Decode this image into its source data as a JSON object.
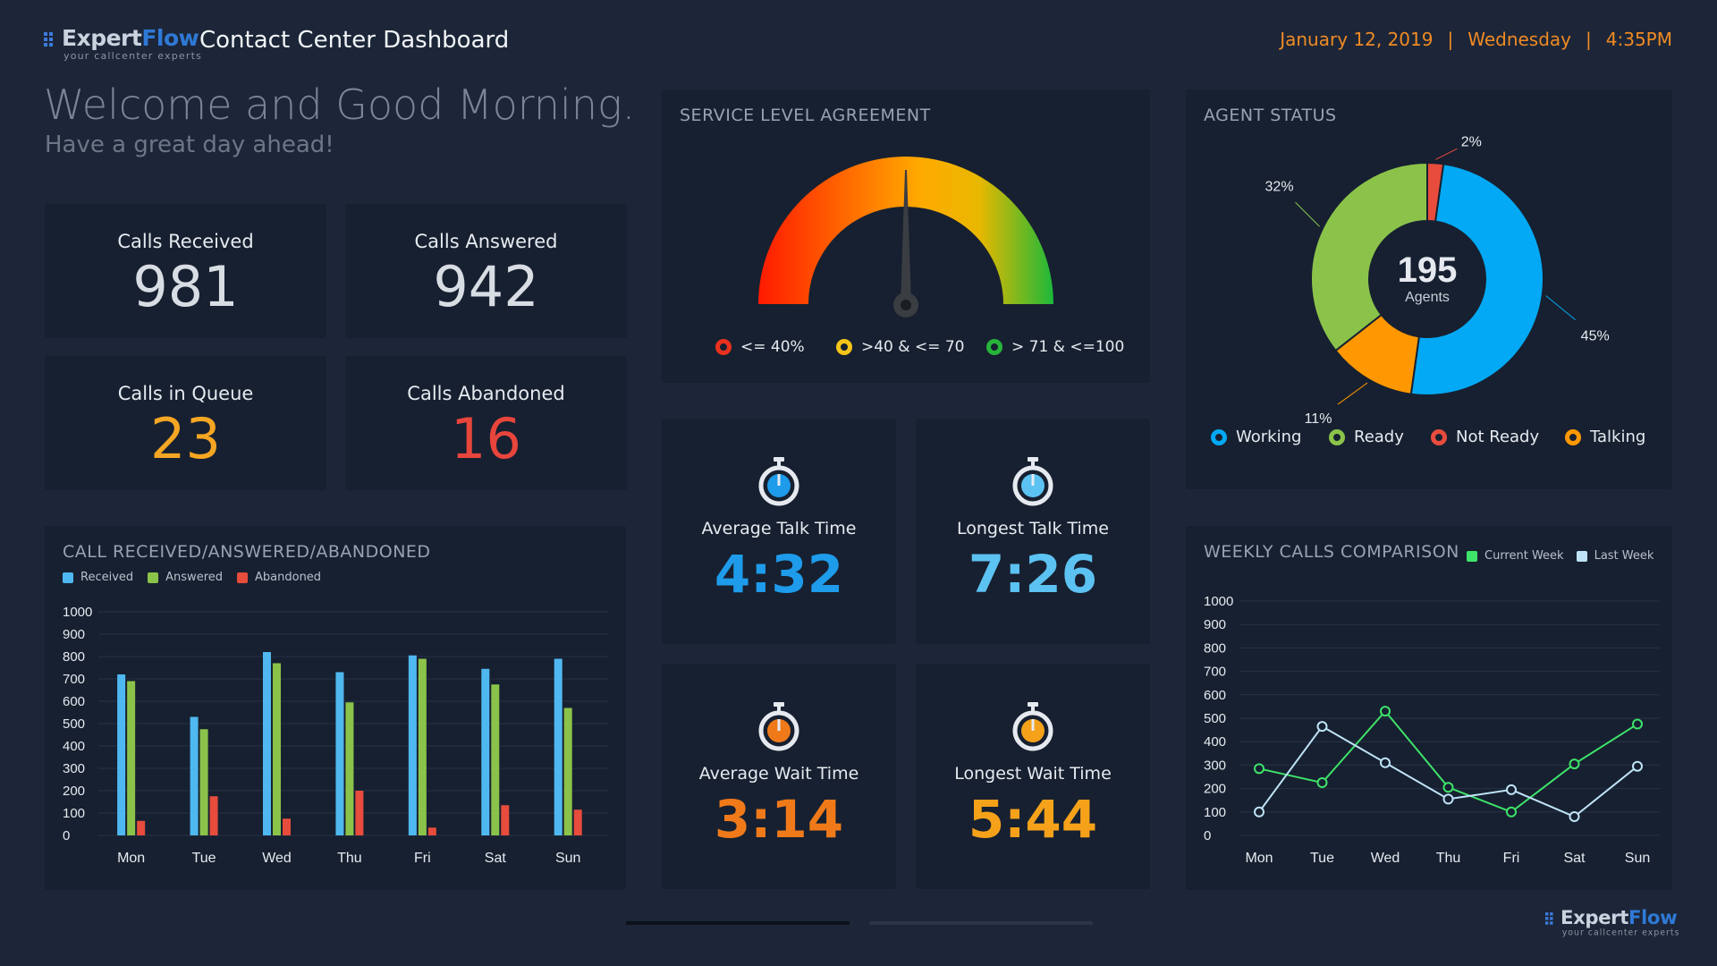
{
  "header": {
    "logo_part1": "Expert",
    "logo_part2": "Flow",
    "logo_tagline": "your callcenter experts",
    "title": "Contact Center Dashboard",
    "date": "January 12, 2019",
    "weekday": "Wednesday",
    "time": "4:35PM",
    "separator": "|"
  },
  "welcome": {
    "headline": "Welcome and Good Morning.",
    "subline": "Have a great day ahead!"
  },
  "kpis": [
    {
      "label": "Calls Received",
      "value": "981",
      "color": "#d8dde4"
    },
    {
      "label": "Calls Answered",
      "value": "942",
      "color": "#d8dde4"
    },
    {
      "label": "Calls in Queue",
      "value": "23",
      "color": "#f5a623"
    },
    {
      "label": "Calls Abandoned",
      "value": "16",
      "color": "#e8453c"
    }
  ],
  "sla": {
    "title": "SERVICE LEVEL AGREEMENT",
    "needle_value_percent": 50,
    "legend": [
      {
        "label": "<= 40%",
        "color": "#e8321f"
      },
      {
        "label": ">40 & <= 70",
        "color": "#f5c518"
      },
      {
        "label": "> 71 & <=100",
        "color": "#27b43a"
      }
    ]
  },
  "timers": [
    {
      "label": "Average Talk Time",
      "value": "4:32",
      "color": "#1e9bea",
      "icon": "stopwatch-icon"
    },
    {
      "label": "Longest Talk Time",
      "value": "7:26",
      "color": "#5cc2f2",
      "icon": "stopwatch-icon"
    },
    {
      "label": "Average Wait Time",
      "value": "3:14",
      "color": "#f07a1a",
      "icon": "stopwatch-icon"
    },
    {
      "label": "Longest Wait Time",
      "value": "5:44",
      "color": "#f5a21a",
      "icon": "stopwatch-icon"
    }
  ],
  "agent_status": {
    "title": "AGENT STATUS",
    "total": "195",
    "total_label": "Agents",
    "legend": [
      {
        "label": "Working",
        "color": "#03a9f4"
      },
      {
        "label": "Ready",
        "color": "#8bc34a"
      },
      {
        "label": "Not Ready",
        "color": "#e74c3c"
      },
      {
        "label": "Talking",
        "color": "#ff9800"
      }
    ]
  },
  "chart_data": [
    {
      "type": "bar",
      "title": "CALL RECEIVED/ANSWERED/ABANDONED",
      "categories": [
        "Mon",
        "Tue",
        "Wed",
        "Thu",
        "Fri",
        "Sat",
        "Sun"
      ],
      "series": [
        {
          "name": "Received",
          "color": "#4fb8f0",
          "values": [
            720,
            530,
            820,
            730,
            805,
            745,
            790
          ]
        },
        {
          "name": "Answered",
          "color": "#8bc34a",
          "values": [
            690,
            475,
            770,
            595,
            790,
            675,
            570
          ]
        },
        {
          "name": "Abandoned",
          "color": "#e74c3c",
          "values": [
            65,
            175,
            75,
            200,
            35,
            135,
            115
          ]
        }
      ],
      "yticks": [
        "0",
        "100",
        "200",
        "300",
        "400",
        "500",
        "600",
        "700",
        "800",
        "900",
        "1000"
      ],
      "ylim": [
        0,
        1000
      ],
      "grid": true,
      "legend": "top-left"
    },
    {
      "type": "pie",
      "title": "AGENT STATUS",
      "labels": [
        "Not Ready",
        "Working",
        "Talking",
        "Ready"
      ],
      "values": [
        2,
        45,
        11,
        32
      ],
      "label_texts": [
        "2%",
        "45%",
        "11%",
        "32%"
      ],
      "colors": [
        "#e74c3c",
        "#03a9f4",
        "#ff9800",
        "#8bc34a"
      ],
      "note": "donut"
    },
    {
      "type": "line",
      "title": "WEEKLY CALLS COMPARISON",
      "categories": [
        "Mon",
        "Tue",
        "Wed",
        "Thu",
        "Fri",
        "Sat",
        "Sun"
      ],
      "series": [
        {
          "name": "Current Week",
          "color": "#3ee36a",
          "values": [
            285,
            225,
            530,
            205,
            100,
            305,
            475
          ]
        },
        {
          "name": "Last Week",
          "color": "#bfe3f7",
          "values": [
            100,
            465,
            310,
            155,
            195,
            80,
            295
          ]
        }
      ],
      "yticks": [
        "0",
        "100",
        "200",
        "300",
        "400",
        "500",
        "600",
        "700",
        "800",
        "900",
        "1000"
      ],
      "ylim": [
        0,
        1000
      ],
      "grid": true,
      "legend": "top-right"
    }
  ],
  "footer": {
    "logo_part1": "Expert",
    "logo_part2": "Flow",
    "logo_tagline": "your callcenter experts"
  }
}
